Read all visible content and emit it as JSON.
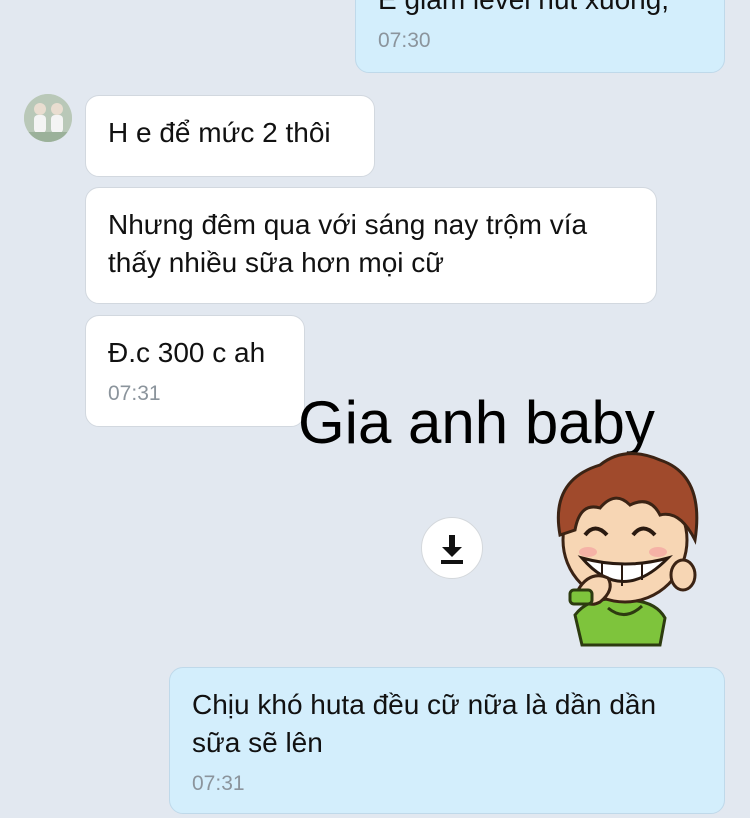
{
  "messages": [
    {
      "id": "m0",
      "side": "outgoing",
      "lines": [
        "E giảm level hút xuống,"
      ],
      "time": "07:30"
    },
    {
      "id": "m1",
      "side": "incoming",
      "lines": [
        "H e để mức 2 thôi"
      ],
      "time": ""
    },
    {
      "id": "m2",
      "side": "incoming",
      "lines": [
        "Nhưng đêm qua với sáng nay trộm vía",
        "thấy nhiều sữa hơn mọi cữ"
      ],
      "time": ""
    },
    {
      "id": "m3",
      "side": "incoming",
      "lines": [
        "Đ.c 300 c ah"
      ],
      "time": "07:31"
    },
    {
      "id": "m4",
      "side": "outgoing",
      "lines": [
        "Chịu khó huta đều cữ nữa là dần dần",
        "sữa sẽ lên"
      ],
      "time": "07:31"
    }
  ],
  "sticker": {
    "caption": "Gia anh baby",
    "icon": "smiling-boy-sticker",
    "download_icon": "download-icon"
  },
  "colors": {
    "background": "#e2e8f0",
    "incoming_bubble": "#ffffff",
    "outgoing_bubble": "#d3eefc"
  }
}
